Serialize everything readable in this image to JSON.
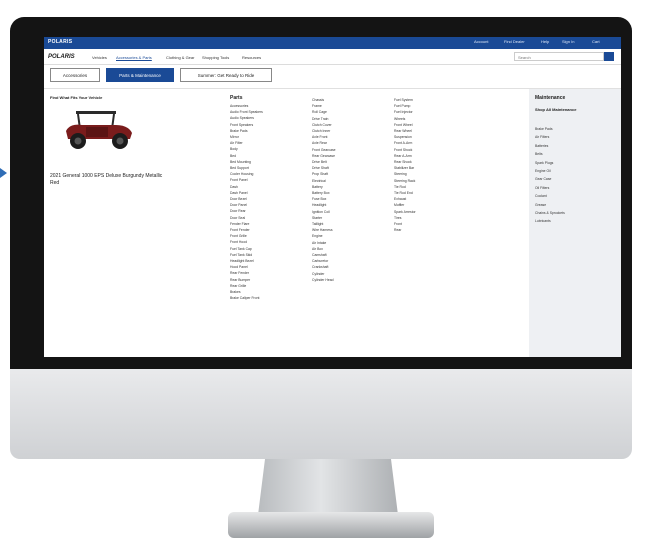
{
  "header": {
    "brand": "POLARIS",
    "utility_links": [
      "Account",
      "Find Dealer",
      "Help",
      "Sign In",
      "Cart"
    ]
  },
  "nav": {
    "logo": "POLARIS",
    "items": [
      "Vehicles",
      "Accessories & Parts",
      "Clothing & Gear",
      "Shopping Tools",
      "Resources"
    ],
    "active_index": 1,
    "search_placeholder": "Search"
  },
  "tabs": [
    "Accessories",
    "Parts & Maintenance",
    "Summer: Get Ready to Ride"
  ],
  "active_tab": 1,
  "fitment": {
    "heading": "Find What Fits Your Vehicle",
    "vehicle_name": "2021 General 1000 EPS Deluxe Burgundy Metallic",
    "vehicle_sub": "Red"
  },
  "parts": {
    "heading": "Parts",
    "col1": [
      "Accessories",
      "Audio Front Speakers",
      "Audio Speakers",
      "Front Speakers",
      "Brake Pads",
      "Mirror",
      "Air Filter",
      "Body",
      "Bed",
      "Bed Mounting",
      "Bed Support",
      "Cooler Housing",
      "Front Panel",
      "Dash",
      "Dash Panel",
      "Door Bezel",
      "Door Panel",
      "Door Rear",
      "Door Seal",
      "Fender Flare",
      "Front Fender",
      "Front Grille",
      "Front Hood",
      "Fuel Tank Cap",
      "Fuel Tank Skid",
      "Headlight Bezel",
      "Hood Panel",
      "Rear Fender",
      "Rear Bumper",
      "Rear Grille",
      "Brakes",
      "Brake Caliper Front"
    ],
    "col2": [
      "Chassis",
      "Frame",
      "Roll Cage",
      "Drive Train",
      "Clutch Cover",
      "Clutch Inner",
      "Axle Front",
      "Axle Rear",
      "Front Gearcase",
      "Rear Gearcase",
      "Drive Belt",
      "Drive Shaft",
      "Prop Shaft",
      "Electrical",
      "Battery",
      "Battery Box",
      "Fuse Box",
      "Headlight",
      "Ignition Coil",
      "Starter",
      "Taillight",
      "Wire Harness",
      "Engine",
      "Air Intake",
      "Air Box",
      "Camshaft",
      "Carburetor",
      "Crankshaft",
      "Cylinder",
      "Cylinder Head"
    ],
    "col3": [
      "Fuel System",
      "Fuel Pump",
      "Fuel Injector",
      "Wheels",
      "Front Wheel",
      "Rear Wheel",
      "Suspension",
      "Front A-Arm",
      "Front Shock",
      "Rear A-Arm",
      "Rear Shock",
      "Stabilizer Bar",
      "Steering",
      "Steering Rack",
      "Tie Rod",
      "Tie Rod End",
      "Exhaust",
      "Muffler",
      "Spark Arrestor",
      "Tires",
      "Front",
      "Rear"
    ]
  },
  "sidebar": {
    "heading": "Maintenance",
    "subheading": "Shop All Maintenance",
    "items": [
      "Brake Pads",
      "Air Filters",
      "Batteries",
      "Belts",
      "Spark Plugs",
      "Engine Oil",
      "Gear Case",
      "Oil Filters",
      "Coolant",
      "Grease",
      "Chains & Sprockets",
      "Lubricants"
    ]
  }
}
